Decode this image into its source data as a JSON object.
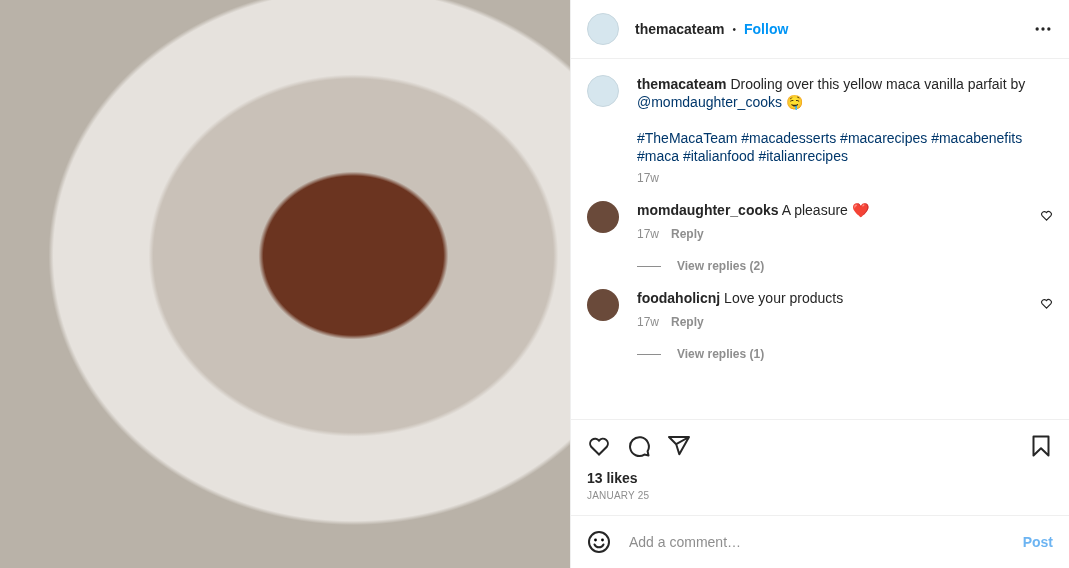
{
  "post": {
    "username": "themacateam",
    "follow": "Follow",
    "separator": "•"
  },
  "caption": {
    "username": "themacateam",
    "text": "Drooling over this yellow maca vanilla parfait by",
    "mention": "@momdaughter_cooks",
    "emoji": "🤤",
    "hashtags": [
      "#TheMacaTeam",
      "#macadesserts",
      "#macarecipes",
      "#macabenefits",
      "#maca",
      "#italianfood",
      "#italianrecipes"
    ],
    "time": "17w"
  },
  "comments": [
    {
      "username": "momdaughter_cooks",
      "text": "A pleasure ❤️",
      "time": "17w",
      "reply": "Reply",
      "view_replies": "View replies (2)",
      "liked": false
    },
    {
      "username": "foodaholicnj",
      "text": "Love your products",
      "time": "17w",
      "reply": "Reply",
      "view_replies": "View replies (1)",
      "liked": false
    }
  ],
  "actions": {
    "liked": false,
    "saved": false
  },
  "likes": "13 likes",
  "date": "JANUARY 25",
  "comment_box": {
    "placeholder": "Add a comment…",
    "post": "Post",
    "disabled": true
  }
}
